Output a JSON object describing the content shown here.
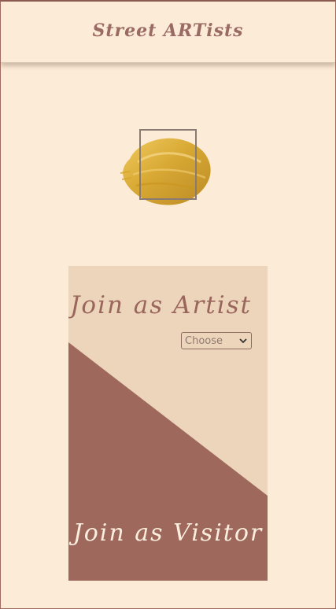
{
  "header": {
    "title": "Street ARTists"
  },
  "logo": {
    "icon": "gold-paint-brush-stroke-logo",
    "colors": {
      "paint": "#d6a52b",
      "frame": "#8a7a74"
    }
  },
  "join_card": {
    "artist": {
      "label": "Join as Artist",
      "select_value": "Choose"
    },
    "visitor": {
      "label": "Join as Visitor"
    },
    "colors": {
      "artist_bg": "#ecd5bb",
      "visitor_bg": "#9e695c",
      "artist_text": "#9a655c",
      "visitor_text": "#fbeede"
    }
  }
}
